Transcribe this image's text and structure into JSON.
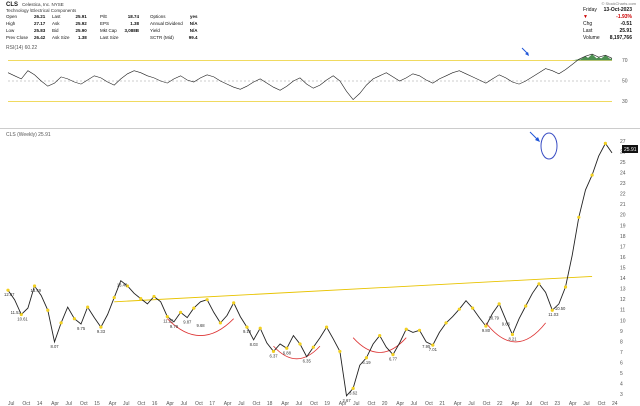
{
  "header": {
    "ticker": "CLS",
    "company": "Celestica, Inc.  NYSE",
    "sector": "Technology \\Electrical Components",
    "watermark": "© StockCharts.com",
    "quote_left": [
      {
        "k": "Open",
        "v": "26.21"
      },
      {
        "k": "High",
        "v": "27.17"
      },
      {
        "k": "Low",
        "v": "25.83"
      },
      {
        "k": "Prev Close",
        "v": "26.42"
      }
    ],
    "quote_mid1": [
      {
        "k": "Last",
        "v": "25.91"
      },
      {
        "k": "Ask",
        "v": "25.92"
      },
      {
        "k": "Bid",
        "v": "25.90"
      },
      {
        "k": "Ask Size",
        "v": "1.38"
      }
    ],
    "quote_mid2": [
      {
        "k": "P/E",
        "v": "18.74"
      },
      {
        "k": "EPS",
        "v": "1.38"
      },
      {
        "k": "Mkt Cap",
        "v": "3,088B"
      },
      {
        "k": "Last Size",
        "v": ""
      }
    ],
    "quote_mid3": [
      {
        "k": "Options",
        "v": "yes"
      },
      {
        "k": "Annual Dividend",
        "v": "N/A"
      },
      {
        "k": "Yield",
        "v": "N/A"
      },
      {
        "k": "SCTR (Mid)",
        "v": "99.4"
      }
    ],
    "right_quote": [
      {
        "k": "Friday",
        "v": "13-Oct-2023"
      },
      {
        "k": "▼",
        "v": "-1.93%"
      },
      {
        "k": "Chg",
        "v": "-0.51"
      },
      {
        "k": "Last",
        "v": "25.91"
      },
      {
        "k": "Volume",
        "v": "8,197,766"
      }
    ]
  },
  "rsi": {
    "label": "RSI(14) 60.22",
    "levels": [
      {
        "v": 70,
        "label": "70"
      },
      {
        "v": 50,
        "label": "50"
      },
      {
        "v": 30,
        "label": "30"
      }
    ]
  },
  "price_panel_label": "CLS (Weekly) 25.91",
  "last_price_tag": "25.91",
  "colors": {
    "up": "#1a1a1a",
    "price_line": "#222",
    "level_yellow": "#e8c300",
    "arc_red": "#d33",
    "arrow_blue": "#1f55d8",
    "rsi_green": "#2e7d32",
    "tag_bg": "#111"
  },
  "chart_data": {
    "type": "line",
    "x_ticks": [
      "Jul",
      "Oct",
      "14",
      "Apr",
      "Jul",
      "Oct",
      "15",
      "Apr",
      "Jul",
      "Oct",
      "16",
      "Apr",
      "Jul",
      "Oct",
      "17",
      "Apr",
      "Jul",
      "Oct",
      "18",
      "Apr",
      "Jul",
      "Oct",
      "19",
      "Apr",
      "Jul",
      "Oct",
      "20",
      "Apr",
      "Jul",
      "Oct",
      "21",
      "Apr",
      "Jul",
      "Oct",
      "22",
      "Apr",
      "Jul",
      "Oct",
      "23",
      "Apr",
      "Jul",
      "Oct",
      "24"
    ],
    "y_ticks": [
      3,
      4,
      5,
      6,
      7,
      8,
      9,
      10,
      11,
      12,
      13,
      14,
      15,
      16,
      17,
      18,
      19,
      20,
      21,
      22,
      23,
      24,
      25,
      26,
      27
    ],
    "ylim": [
      2.5,
      27.5
    ],
    "price_series": [
      [
        0,
        12.9
      ],
      [
        1,
        12.0
      ],
      [
        2,
        10.6
      ],
      [
        3,
        11.2
      ],
      [
        4,
        13.3
      ],
      [
        5,
        12.4
      ],
      [
        6,
        11.0
      ],
      [
        7,
        8.0
      ],
      [
        8,
        9.8
      ],
      [
        9,
        11.3
      ],
      [
        10,
        10.2
      ],
      [
        11,
        9.7
      ],
      [
        12,
        11.3
      ],
      [
        13,
        10.3
      ],
      [
        14,
        9.4
      ],
      [
        15,
        10.6
      ],
      [
        16,
        12.2
      ],
      [
        17,
        13.8
      ],
      [
        18,
        13.3
      ],
      [
        19,
        12.6
      ],
      [
        20,
        12.1
      ],
      [
        21,
        11.6
      ],
      [
        22,
        12.3
      ],
      [
        23,
        11.8
      ],
      [
        24,
        10.4
      ],
      [
        25,
        9.9
      ],
      [
        26,
        10.8
      ],
      [
        27,
        10.3
      ],
      [
        28,
        11.2
      ],
      [
        29,
        11.8
      ],
      [
        30,
        12.0
      ],
      [
        31,
        10.8
      ],
      [
        32,
        9.8
      ],
      [
        33,
        10.5
      ],
      [
        34,
        11.7
      ],
      [
        35,
        10.4
      ],
      [
        36,
        9.4
      ],
      [
        37,
        8.2
      ],
      [
        38,
        9.3
      ],
      [
        39,
        7.9
      ],
      [
        40,
        7.1
      ],
      [
        41,
        7.8
      ],
      [
        42,
        7.4
      ],
      [
        43,
        8.6
      ],
      [
        44,
        7.8
      ],
      [
        45,
        6.6
      ],
      [
        46,
        7.5
      ],
      [
        47,
        8.4
      ],
      [
        48,
        9.4
      ],
      [
        49,
        8.3
      ],
      [
        50,
        7.1
      ],
      [
        51,
        2.9
      ],
      [
        52,
        3.6
      ],
      [
        53,
        5.8
      ],
      [
        54,
        6.5
      ],
      [
        55,
        7.8
      ],
      [
        56,
        8.6
      ],
      [
        57,
        7.5
      ],
      [
        58,
        6.8
      ],
      [
        59,
        7.9
      ],
      [
        60,
        9.2
      ],
      [
        61,
        8.9
      ],
      [
        62,
        9.1
      ],
      [
        63,
        8.0
      ],
      [
        64,
        7.7
      ],
      [
        65,
        8.9
      ],
      [
        66,
        9.8
      ],
      [
        67,
        10.4
      ],
      [
        68,
        11.1
      ],
      [
        69,
        11.9
      ],
      [
        70,
        11.2
      ],
      [
        71,
        10.3
      ],
      [
        72,
        9.5
      ],
      [
        73,
        10.7
      ],
      [
        74,
        11.6
      ],
      [
        75,
        10.1
      ],
      [
        76,
        8.7
      ],
      [
        77,
        10.2
      ],
      [
        78,
        11.4
      ],
      [
        79,
        12.6
      ],
      [
        80,
        13.5
      ],
      [
        81,
        12.7
      ],
      [
        82,
        11.0
      ],
      [
        83,
        11.6
      ],
      [
        84,
        13.2
      ],
      [
        85,
        16.2
      ],
      [
        86,
        19.8
      ],
      [
        87,
        22.4
      ],
      [
        88,
        23.8
      ],
      [
        89,
        25.6
      ],
      [
        90,
        26.8
      ],
      [
        91,
        25.9
      ]
    ],
    "x_count": 92,
    "labels": [
      {
        "x": 0,
        "y": 12.9,
        "t": "12.87"
      },
      {
        "x": 4,
        "y": 13.3,
        "t": "13.49"
      },
      {
        "x": 2,
        "y": 10.6,
        "t": "10.61"
      },
      {
        "x": 1,
        "y": 11.2,
        "t": "11.53"
      },
      {
        "x": 7,
        "y": 8.0,
        "t": "8.07"
      },
      {
        "x": 11,
        "y": 9.7,
        "t": "9.75"
      },
      {
        "x": 14,
        "y": 9.4,
        "t": "9.33"
      },
      {
        "x": 17,
        "y": 13.8,
        "t": "13.46"
      },
      {
        "x": 24,
        "y": 10.4,
        "t": "11.25"
      },
      {
        "x": 25,
        "y": 9.9,
        "t": "9.79"
      },
      {
        "x": 27,
        "y": 10.3,
        "t": "9.87"
      },
      {
        "x": 29,
        "y": 10.0,
        "t": "9.68"
      },
      {
        "x": 36,
        "y": 9.4,
        "t": "9.18"
      },
      {
        "x": 37,
        "y": 8.2,
        "t": "8.03"
      },
      {
        "x": 40,
        "y": 7.1,
        "t": "6.37"
      },
      {
        "x": 42,
        "y": 7.4,
        "t": "6.88"
      },
      {
        "x": 45,
        "y": 6.6,
        "t": "6.35"
      },
      {
        "x": 51,
        "y": 2.9,
        "t": "2.67"
      },
      {
        "x": 52,
        "y": 3.6,
        "t": "3.62"
      },
      {
        "x": 54,
        "y": 6.5,
        "t": "6.19"
      },
      {
        "x": 58,
        "y": 6.8,
        "t": "6.77"
      },
      {
        "x": 63,
        "y": 8.0,
        "t": "7.95"
      },
      {
        "x": 64,
        "y": 7.7,
        "t": "7.01"
      },
      {
        "x": 72,
        "y": 9.5,
        "t": "9.80"
      },
      {
        "x": 73,
        "y": 10.7,
        "t": "10.79"
      },
      {
        "x": 75,
        "y": 10.1,
        "t": "9.66"
      },
      {
        "x": 76,
        "y": 8.7,
        "t": "8.21"
      },
      {
        "x": 82,
        "y": 11.0,
        "t": "11.03"
      },
      {
        "x": 83,
        "y": 11.6,
        "t": "10.50"
      }
    ],
    "resistance_line": {
      "x0": 16,
      "y0": 11.8,
      "x1": 88,
      "y1": 14.2
    },
    "arcs": [
      {
        "x0": 24,
        "x1": 34,
        "y": 10.2,
        "depth": 1.6
      },
      {
        "x0": 40,
        "x1": 47,
        "y": 7.6,
        "depth": 1.2
      },
      {
        "x0": 52,
        "x1": 60,
        "y": 8.4,
        "depth": 1.4
      },
      {
        "x0": 72,
        "x1": 81,
        "y": 9.8,
        "depth": 1.8
      }
    ],
    "rsi_values": [
      58,
      55,
      52,
      60,
      56,
      50,
      45,
      48,
      54,
      52,
      49,
      47,
      51,
      55,
      53,
      49,
      46,
      52,
      57,
      60,
      58,
      55,
      53,
      50,
      48,
      52,
      55,
      51,
      49,
      53,
      56,
      54,
      50,
      47,
      44,
      42,
      45,
      49,
      52,
      48,
      44,
      41,
      45,
      50,
      53,
      47,
      43,
      46,
      51,
      55,
      50,
      40,
      32,
      38,
      46,
      52,
      55,
      58,
      54,
      50,
      53,
      57,
      55,
      51,
      48,
      52,
      55,
      58,
      60,
      57,
      54,
      51,
      48,
      52,
      56,
      53,
      49,
      47,
      50,
      54,
      58,
      62,
      60,
      57,
      61,
      66,
      71,
      74,
      76,
      73,
      75,
      72
    ],
    "title": "",
    "ylabel": ""
  }
}
